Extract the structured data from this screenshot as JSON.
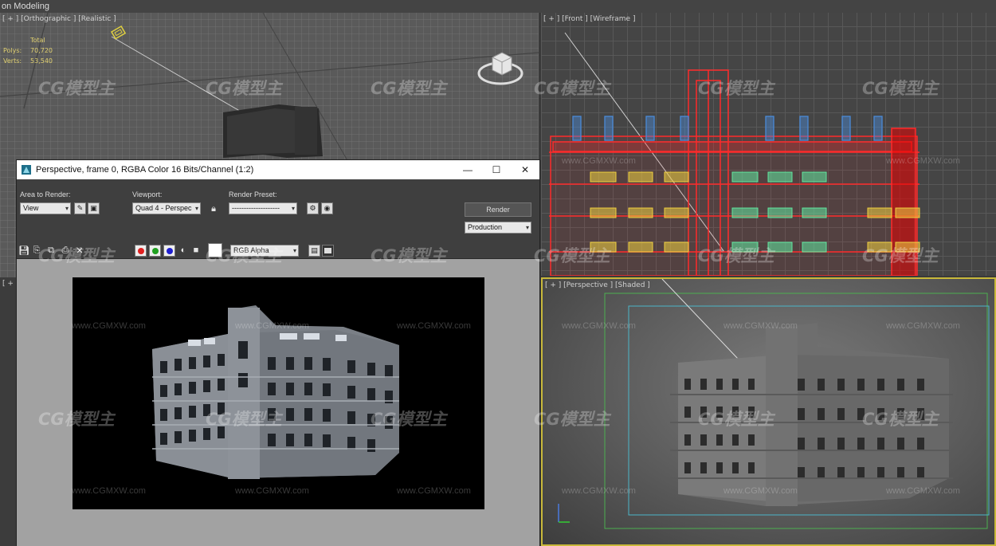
{
  "app": {
    "ribbon_title": "on Modeling"
  },
  "viewports": {
    "top_left": {
      "label": "[ + ] [Orthographic ] [Realistic ]"
    },
    "front": {
      "label": "[ + ] [Front ] [Wireframe ]"
    },
    "perspective": {
      "label": "[ + ] [Perspective ] [Shaded ]"
    },
    "bottom_left": {
      "label": "[ + ]"
    }
  },
  "stats": {
    "header": "Total",
    "polys_label": "Polys:",
    "polys_value": "70,720",
    "verts_label": "Verts:",
    "verts_value": "53,540"
  },
  "render_window": {
    "title": "Perspective, frame 0, RGBA Color 16 Bits/Channel (1:2)",
    "minimize": "—",
    "maximize": "☐",
    "close": "✕",
    "area_label": "Area to Render:",
    "area_value": "View",
    "viewport_label": "Viewport:",
    "viewport_value": "Quad 4 - Perspec",
    "preset_label": "Render Preset:",
    "preset_value": "--------------------",
    "render_button": "Render",
    "mode_value": "Production",
    "channel_value": "RGB Alpha"
  },
  "watermarks": {
    "logo": "CG模型主",
    "url": "www.CGMXW.com"
  },
  "colors": {
    "viewport_border_active": "#c8b83a",
    "wire_red": "#ff2a2a",
    "wire_blue": "#4a8ad8",
    "wire_yellow": "#f0d040",
    "wire_green": "#60e8a0"
  },
  "icons": [
    "app-icon",
    "save-icon",
    "copy-icon",
    "clone-icon",
    "print-icon",
    "clear-icon",
    "lock-icon",
    "render-setup-icon",
    "environment-icon",
    "display-icon"
  ]
}
